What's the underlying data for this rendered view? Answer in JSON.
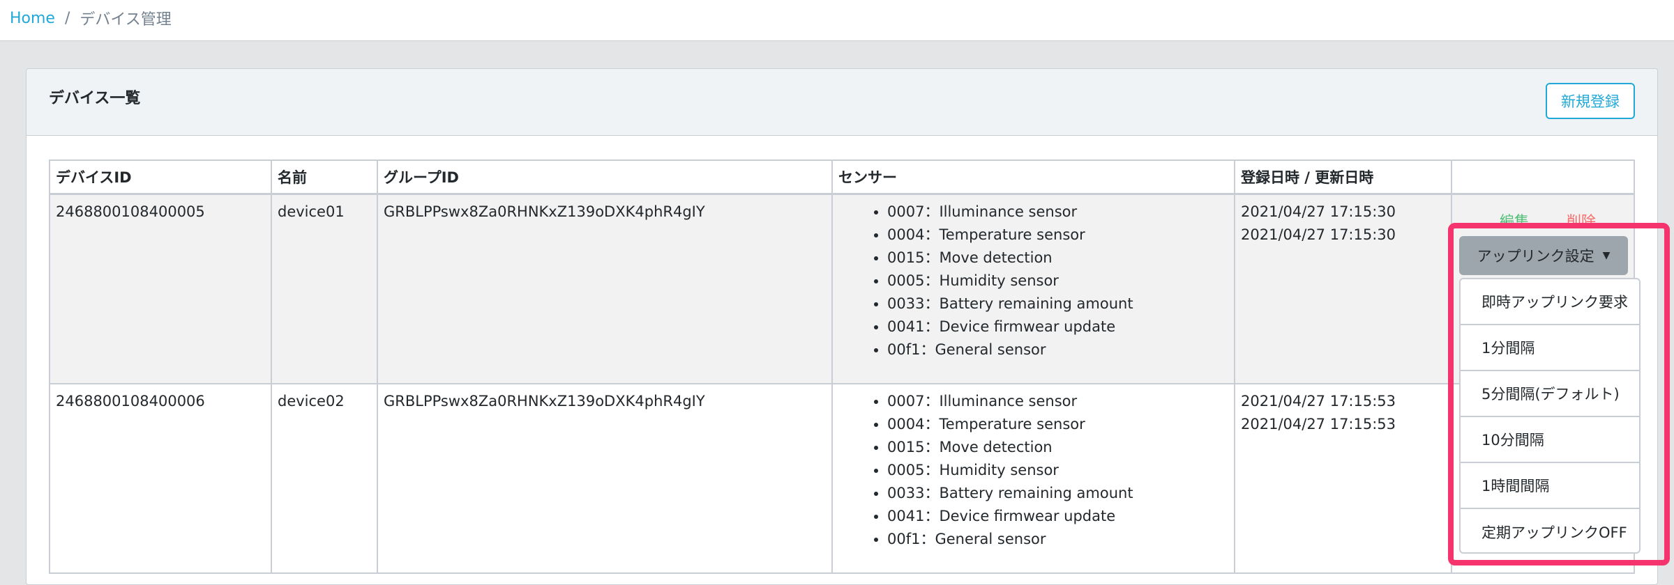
{
  "breadcrumb": {
    "home": "Home",
    "separator": "/",
    "current": "デバイス管理"
  },
  "card": {
    "title": "デバイス一覧",
    "new_button": "新規登録"
  },
  "table": {
    "headers": [
      "デバイスID",
      "名前",
      "グループID",
      "センサー",
      "登録日時 / 更新日時",
      ""
    ],
    "rows": [
      {
        "device_id": "2468800108400005",
        "name": "device01",
        "group_id": "GRBLPPswx8Za0RHNKxZ139oDXK4phR4gIY",
        "sensors": [
          "0007：Illuminance sensor",
          "0004：Temperature sensor",
          "0015：Move detection",
          "0005：Humidity sensor",
          "0033：Battery remaining amount",
          "0041：Device firmwear update",
          "00f1：General sensor"
        ],
        "registered": "2021/04/27 17:15:30",
        "updated": "2021/04/27 17:15:30",
        "edit": "編集",
        "delete": "削除"
      },
      {
        "device_id": "2468800108400006",
        "name": "device02",
        "group_id": "GRBLPPswx8Za0RHNKxZ139oDXK4phR4gIY",
        "sensors": [
          "0007：Illuminance sensor",
          "0004：Temperature sensor",
          "0015：Move detection",
          "0005：Humidity sensor",
          "0033：Battery remaining amount",
          "0041：Device firmwear update",
          "00f1：General sensor"
        ],
        "registered": "2021/04/27 17:15:53",
        "updated": "2021/04/27 17:15:53"
      }
    ]
  },
  "uplink": {
    "button_label": "アップリンク設定",
    "caret_icon": "caret-down-icon",
    "menu": [
      "即時アップリンク要求",
      "1分間隔",
      "5分間隔(デフォルト)",
      "10分間隔",
      "1時間間隔",
      "定期アップリンクOFF"
    ]
  },
  "colors": {
    "accent": "#20a8d8",
    "edit": "#4dbd74",
    "delete": "#f86c6b",
    "highlight": "#f5336d"
  }
}
